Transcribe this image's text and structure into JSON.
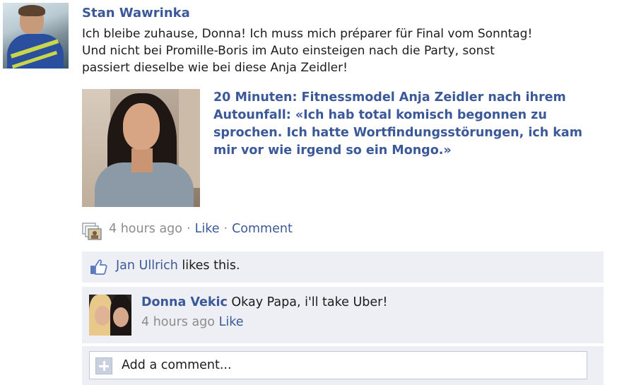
{
  "post": {
    "author": "Stan Wawrinka",
    "text_lines": [
      "Ich bleibe zuhause, Donna! Ich muss mich préparer für Final vom Sonntag!",
      "Und nicht bei Promille-Boris im Auto einsteigen nach die Party, sonst",
      "passiert dieselbe wie bei diese Anja Zeidler!"
    ],
    "link": {
      "title_lines": [
        "20 Minuten: Fitnessmodel Anja Zeidler nach ihrem",
        "Autounfall: «Ich hab total komisch begonnen zu",
        "sprochen. Ich hatte Wortfindungsstörungen, ich kam",
        "mir vor wie irgend so ein Mongo.»"
      ]
    },
    "meta": {
      "time": "4 hours ago",
      "separator": "·",
      "like_label": "Like",
      "comment_label": "Comment"
    }
  },
  "likes": {
    "liker": "Jan Ullrich",
    "suffix": " likes this."
  },
  "comments": [
    {
      "author": "Donna Vekic",
      "text": " Okay Papa, i'll take Uber!",
      "time": "4 hours ago",
      "like_label": "Like"
    }
  ],
  "add_comment": {
    "placeholder": "Add a comment..."
  },
  "colors": {
    "link_blue": "#3b5998",
    "meta_gray": "#8c8c8c",
    "ufi_background": "#edeff4"
  },
  "icons": {
    "meta": "photo-stack-icon",
    "likes": "thumbs-up-icon",
    "add_comment": "plus-icon"
  }
}
